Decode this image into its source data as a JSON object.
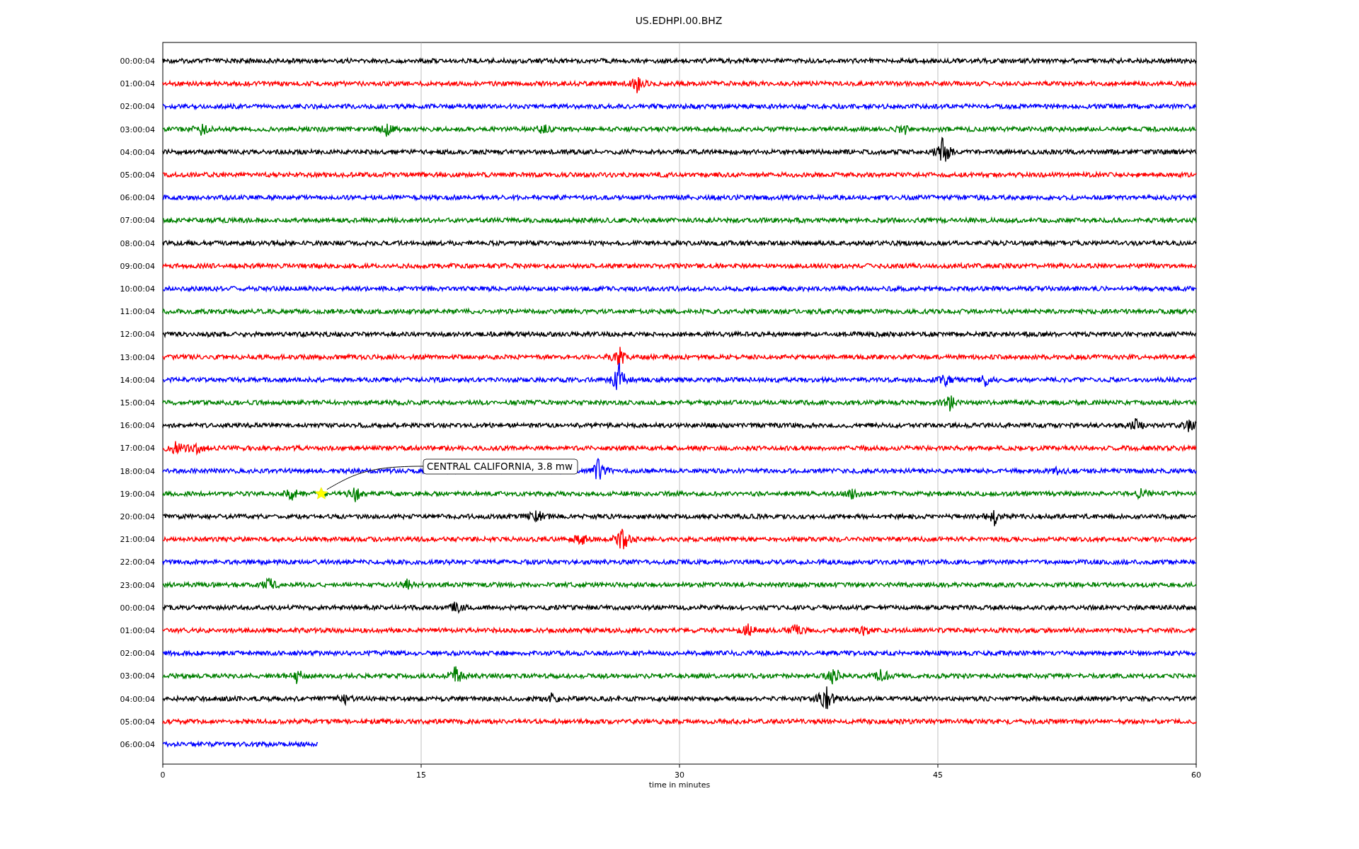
{
  "title": "US.EDHPI.00.BHZ",
  "rows": [
    {
      "label": "00:00:04",
      "color": "#000000"
    },
    {
      "label": "01:00:04",
      "color": "#ff0000"
    },
    {
      "label": "02:00:04",
      "color": "#0000ff"
    },
    {
      "label": "03:00:04",
      "color": "#008000"
    },
    {
      "label": "04:00:04",
      "color": "#000000"
    },
    {
      "label": "05:00:04",
      "color": "#ff0000"
    },
    {
      "label": "06:00:04",
      "color": "#0000ff"
    },
    {
      "label": "07:00:04",
      "color": "#008000"
    },
    {
      "label": "08:00:04",
      "color": "#000000"
    },
    {
      "label": "09:00:04",
      "color": "#ff0000"
    },
    {
      "label": "10:00:04",
      "color": "#0000ff"
    },
    {
      "label": "11:00:04",
      "color": "#008000"
    },
    {
      "label": "12:00:04",
      "color": "#000000"
    },
    {
      "label": "13:00:04",
      "color": "#ff0000"
    },
    {
      "label": "14:00:04",
      "color": "#0000ff"
    },
    {
      "label": "15:00:04",
      "color": "#008000"
    },
    {
      "label": "16:00:04",
      "color": "#000000"
    },
    {
      "label": "17:00:04",
      "color": "#ff0000"
    },
    {
      "label": "18:00:04",
      "color": "#0000ff"
    },
    {
      "label": "19:00:04",
      "color": "#008000"
    },
    {
      "label": "20:00:04",
      "color": "#000000"
    },
    {
      "label": "21:00:04",
      "color": "#ff0000"
    },
    {
      "label": "22:00:04",
      "color": "#0000ff"
    },
    {
      "label": "23:00:04",
      "color": "#008000"
    },
    {
      "label": "00:00:04",
      "color": "#000000"
    },
    {
      "label": "01:00:04",
      "color": "#ff0000"
    },
    {
      "label": "02:00:04",
      "color": "#0000ff"
    },
    {
      "label": "03:00:04",
      "color": "#008000"
    },
    {
      "label": "04:00:04",
      "color": "#000000"
    },
    {
      "label": "05:00:04",
      "color": "#ff0000"
    },
    {
      "label": "06:00:04",
      "color": "#0000ff"
    }
  ],
  "x_ticks": [
    "0",
    "15",
    "30",
    "45",
    "60"
  ],
  "xlabel": "time in minutes",
  "annotation": {
    "text": "CENTRAL CALIFORNIA, 3.8 mw"
  }
}
